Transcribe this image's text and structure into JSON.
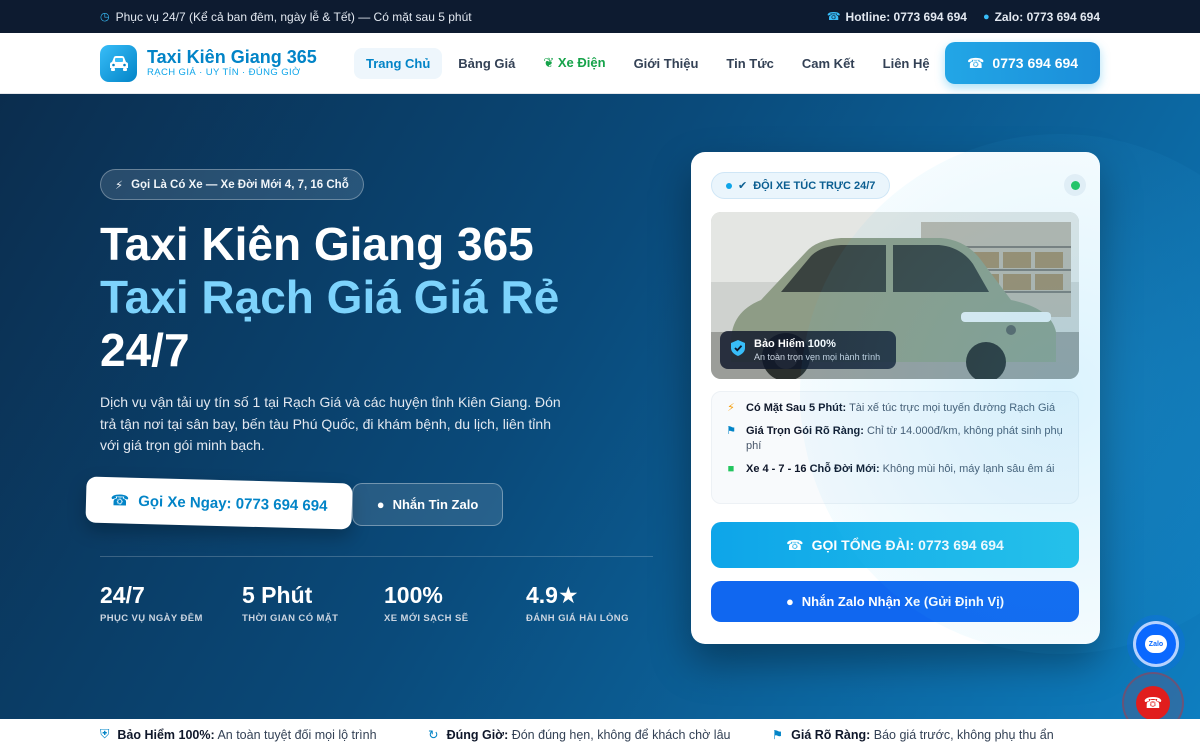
{
  "topbar": {
    "service": "Phục vụ 24/7 (Kể cả ban đêm, ngày lễ & Tết) — Có mặt sau 5 phút",
    "hotline": "Hotline: 0773 694 694",
    "zalo": "Zalo: 0773 694 694"
  },
  "brand": {
    "name": "Taxi Kiên Giang 365",
    "tagline": "RẠCH GIÁ · UY TÍN · ĐÚNG GIỜ"
  },
  "menu": [
    {
      "label": "Trang Chủ"
    },
    {
      "label": "Bảng Giá"
    },
    {
      "label": "Xe Điện"
    },
    {
      "label": "Giới Thiệu"
    },
    {
      "label": "Tin Tức"
    },
    {
      "label": "Cam Kết"
    },
    {
      "label": "Liên Hệ"
    }
  ],
  "nav_cta": "0773 694 694",
  "hero": {
    "badge": "Gọi Là Có Xe — Xe Đời Mới 4, 7, 16 Chỗ",
    "title_line1": "Taxi Kiên Giang 365",
    "title_line2": "Taxi Rạch Giá Giá Rẻ",
    "title_line3": "24/7",
    "lead": "Dịch vụ vận tải uy tín số 1 tại Rạch Giá và các huyện tỉnh Kiên Giang. Đón trả tận nơi tại sân bay, bến tàu Phú Quốc, đi khám bệnh, du lịch, liên tỉnh với giá trọn gói minh bạch.",
    "call_button": "Gọi Xe Ngay: 0773 694 694",
    "zalo_button": "Nhắn Tin Zalo"
  },
  "stats": [
    {
      "value": "24/7",
      "label": "PHỤC VỤ NGÀY ĐÊM"
    },
    {
      "value": "5 Phút",
      "label": "THỜI GIAN CÓ MẶT"
    },
    {
      "value": "100%",
      "label": "XE MỚI SẠCH SẼ"
    },
    {
      "value": "4.9★",
      "label": "ĐÁNH GIÁ HÀI LÒNG"
    }
  ],
  "card": {
    "tag": "ĐỘI XE TÚC TRỰC 24/7",
    "insurance_title": "Bảo Hiểm 100%",
    "insurance_sub": "An toàn trọn vẹn mọi hành trình",
    "features": [
      {
        "title": "Có Mặt Sau 5 Phút:",
        "text": " Tài xế túc trực mọi tuyến đường Rạch Giá"
      },
      {
        "title": "Giá Trọn Gói Rõ Ràng:",
        "text": " Chỉ từ 14.000đ/km, không phát sinh phụ phí"
      },
      {
        "title": "Xe 4 - 7 - 16 Chỗ Đời Mới:",
        "text": " Không mùi hôi, máy lạnh sâu êm ái"
      }
    ],
    "call_button": "GỌI TỔNG ĐÀI: 0773 694 694",
    "zalo_button": "Nhắn Zalo Nhận Xe (Gửi Định Vị)"
  },
  "fab": {
    "zalo_label": "Zalo"
  },
  "strip": [
    {
      "title": "Bảo Hiểm 100%:",
      "text": " An toàn tuyệt đối mọi lộ trình"
    },
    {
      "title": "Đúng Giờ:",
      "text": " Đón đúng hẹn, không để khách chờ lâu"
    },
    {
      "title": "Giá Rõ Ràng:",
      "text": " Báo giá trước, không phụ thu ẩn"
    }
  ],
  "colors": {
    "primary": "#0284c7",
    "accent": "#7dd3fc",
    "zalo": "#1067f0",
    "call": "#e11d1d",
    "ev": "#16a34a"
  }
}
